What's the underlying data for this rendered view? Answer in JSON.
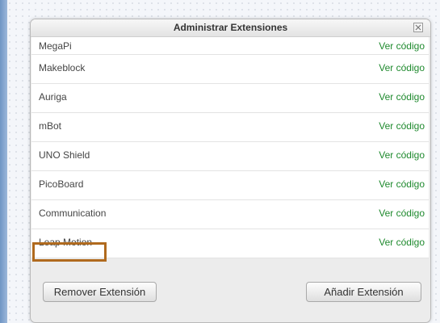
{
  "dialog": {
    "title": "Administrar Extensiones",
    "close_icon": "close-icon"
  },
  "extensions": [
    {
      "name": "MegaPi",
      "action": "Ver código"
    },
    {
      "name": "Makeblock",
      "action": "Ver código"
    },
    {
      "name": "Auriga",
      "action": "Ver código"
    },
    {
      "name": "mBot",
      "action": "Ver código"
    },
    {
      "name": "UNO Shield",
      "action": "Ver código"
    },
    {
      "name": "PicoBoard",
      "action": "Ver código"
    },
    {
      "name": "Communication",
      "action": "Ver código"
    },
    {
      "name": "Leap Motion",
      "action": "Ver código"
    }
  ],
  "footer": {
    "remove_label": "Remover Extensión",
    "add_label": "Añadir Extensión"
  },
  "colors": {
    "link": "#1f8a2e",
    "highlight_border": "#b06a1e",
    "sidebar_stripe": "#6f95c4"
  }
}
